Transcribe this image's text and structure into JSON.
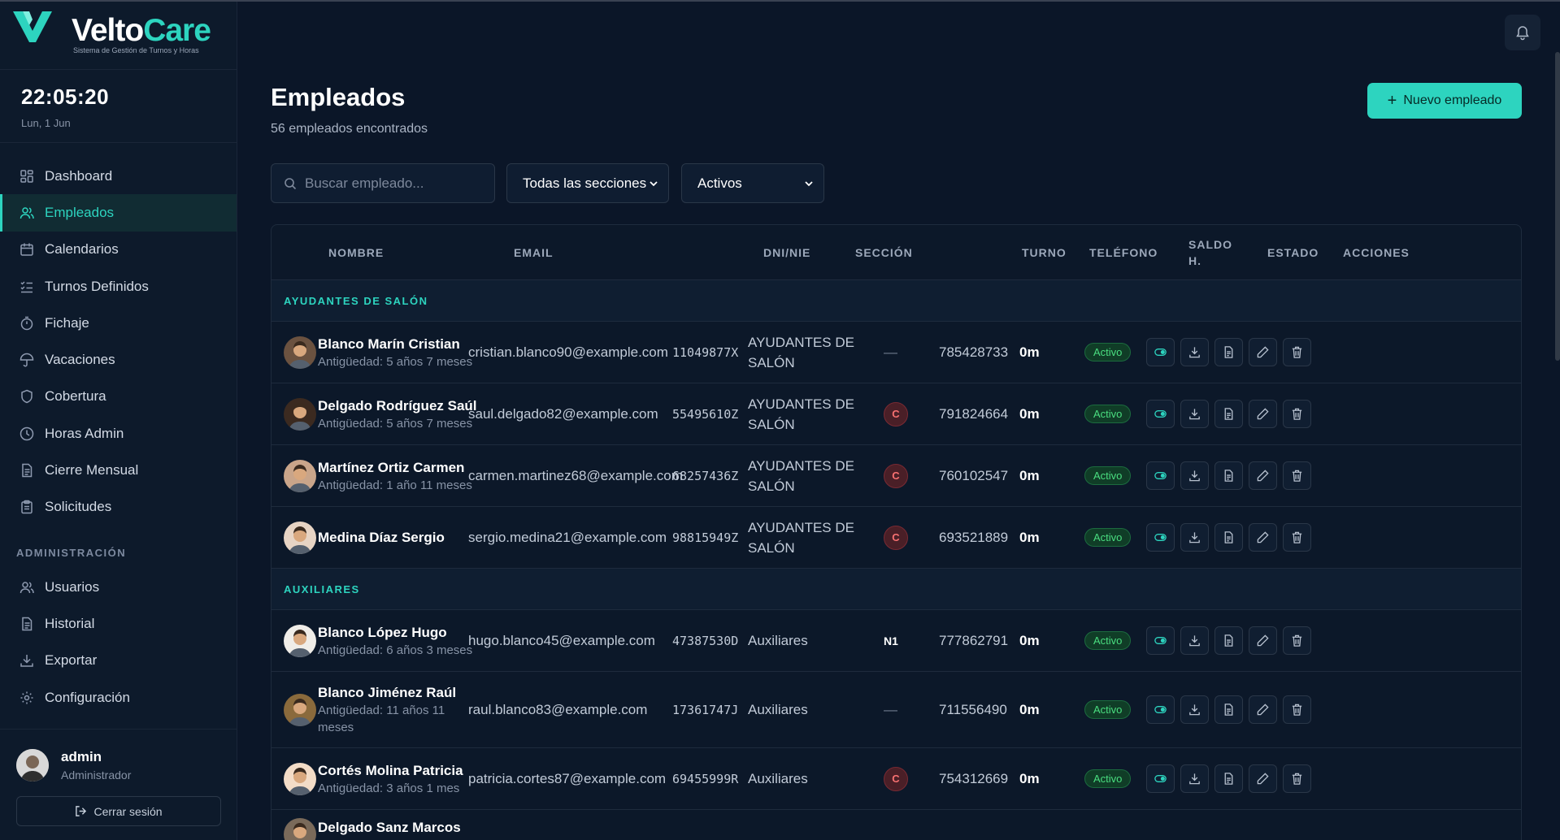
{
  "brand": {
    "name_a": "Velto",
    "name_b": "Care",
    "subtitle": "Sistema de Gestión de Turnos y Horas"
  },
  "clock": {
    "time": "22:05:20",
    "date": "Lun, 1 Jun"
  },
  "nav": {
    "items": [
      "Dashboard",
      "Empleados",
      "Calendarios",
      "Turnos Definidos",
      "Fichaje",
      "Vacaciones",
      "Cobertura",
      "Horas Admin",
      "Cierre Mensual",
      "Solicitudes"
    ],
    "admin_title": "ADMINISTRACIÓN",
    "admin_items": [
      "Usuarios",
      "Historial",
      "Exportar",
      "Configuración"
    ]
  },
  "user": {
    "name": "admin",
    "role": "Administrador",
    "logout": "Cerrar sesión"
  },
  "page": {
    "title": "Empleados",
    "count": "56 empleados encontrados",
    "new_button": "Nuevo empleado"
  },
  "filters": {
    "search_placeholder": "Buscar empleado...",
    "section": "Todas las secciones",
    "status": "Activos"
  },
  "table": {
    "headers": {
      "nombre": "NOMBRE",
      "email": "EMAIL",
      "dni": "DNI/NIE",
      "seccion": "SECCIÓN",
      "turno": "TURNO",
      "telefono": "TELÉFONO",
      "saldo_a": "SALDO",
      "saldo_b": "H.",
      "estado": "ESTADO",
      "acciones": "ACCIONES"
    },
    "groups": [
      {
        "title": "AYUDANTES DE SALÓN",
        "rows": [
          {
            "name": "Blanco Marín Cristian",
            "antiguedad": "Antigüedad: 5 años 7 meses",
            "email": "cristian.blanco90@example.com",
            "dni": "11049877X",
            "seccion_a": "AYUDANTES DE",
            "seccion_b": "SALÓN",
            "turno": "—",
            "tel": "785428733",
            "saldo": "0m",
            "estado": "Activo"
          },
          {
            "name": "Delgado Rodríguez Saúl",
            "antiguedad": "Antigüedad: 5 años 7 meses",
            "email": "saul.delgado82@example.com",
            "dni": "55495610Z",
            "seccion_a": "AYUDANTES DE",
            "seccion_b": "SALÓN",
            "turno": "C",
            "tel": "791824664",
            "saldo": "0m",
            "estado": "Activo"
          },
          {
            "name": "Martínez Ortiz Carmen",
            "antiguedad": "Antigüedad: 1 año 11 meses",
            "email": "carmen.martinez68@example.com",
            "dni": "68257436Z",
            "seccion_a": "AYUDANTES DE",
            "seccion_b": "SALÓN",
            "turno": "C",
            "tel": "760102547",
            "saldo": "0m",
            "estado": "Activo"
          },
          {
            "name": "Medina Díaz Sergio",
            "antiguedad": "",
            "email": "sergio.medina21@example.com",
            "dni": "98815949Z",
            "seccion_a": "AYUDANTES DE",
            "seccion_b": "SALÓN",
            "turno": "C",
            "tel": "693521889",
            "saldo": "0m",
            "estado": "Activo"
          }
        ]
      },
      {
        "title": "AUXILIARES",
        "rows": [
          {
            "name": "Blanco López Hugo",
            "antiguedad": "Antigüedad: 6 años 3 meses",
            "email": "hugo.blanco45@example.com",
            "dni": "47387530D",
            "seccion_a": "Auxiliares",
            "seccion_b": "",
            "turno": "N1",
            "tel": "777862791",
            "saldo": "0m",
            "estado": "Activo"
          },
          {
            "name": "Blanco Jiménez Raúl",
            "antiguedad": "Antigüedad: 11 años 11",
            "antiguedad_b": "meses",
            "email": "raul.blanco83@example.com",
            "dni": "17361747J",
            "seccion_a": "Auxiliares",
            "seccion_b": "",
            "turno": "—",
            "tel": "711556490",
            "saldo": "0m",
            "estado": "Activo"
          },
          {
            "name": "Cortés Molina Patricia",
            "antiguedad": "Antigüedad: 3 años 1 mes",
            "email": "patricia.cortes87@example.com",
            "dni": "69455999R",
            "seccion_a": "Auxiliares",
            "seccion_b": "",
            "turno": "C",
            "tel": "754312669",
            "saldo": "0m",
            "estado": "Activo"
          },
          {
            "name": "Delgado Sanz Marcos",
            "antiguedad": "",
            "email": "",
            "dni": "",
            "seccion_a": "",
            "seccion_b": "",
            "turno": "",
            "tel": "",
            "saldo": "",
            "estado": ""
          }
        ]
      }
    ]
  },
  "colors": {
    "accent": "#2dd4bf",
    "bg": "#0b1628",
    "badge_green": "#4ade80",
    "turno_red": "#f87171"
  }
}
